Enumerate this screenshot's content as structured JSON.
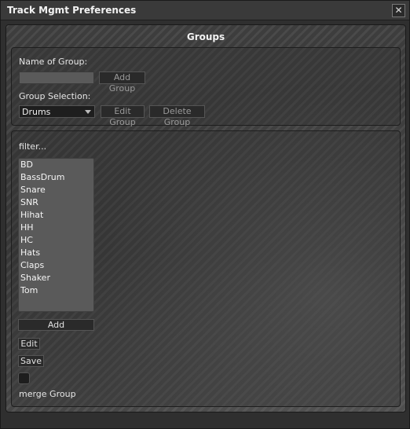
{
  "window": {
    "title": "Track Mgmt Preferences",
    "close_glyph": "✕"
  },
  "groups": {
    "heading": "Groups",
    "name_label": "Name of Group:",
    "name_value": "",
    "add_group_label": "Add Group",
    "selection_label": "Group Selection:",
    "selected_group": "Drums",
    "edit_group_label": "Edit Group",
    "delete_group_label": "Delete Group"
  },
  "tracks": {
    "filter_label": "filter...",
    "items": [
      "BD",
      "BassDrum",
      "Snare",
      "SNR",
      "Hihat",
      "HH",
      "HC",
      "Hats",
      "Claps",
      "Shaker",
      "Tom"
    ],
    "add_label": "Add",
    "edit_label": "Edit",
    "save_label": "Save",
    "merge_label": "merge Group",
    "merge_checked": false
  }
}
